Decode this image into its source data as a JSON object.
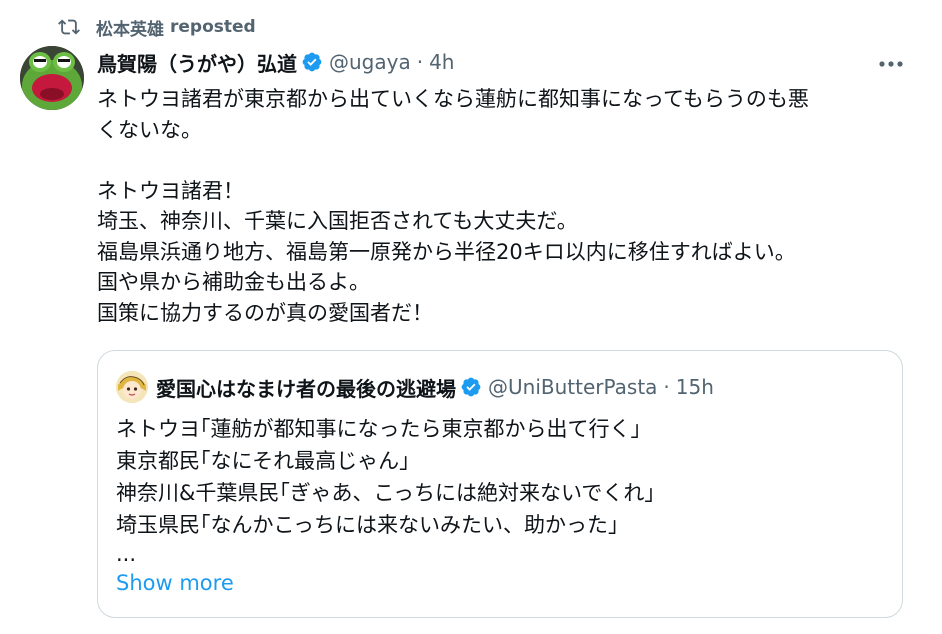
{
  "repost": {
    "user": "松本英雄",
    "label": "reposted",
    "icon": "repost-icon"
  },
  "post": {
    "display_name": "鳥賀陽（うがや）弘道",
    "handle": "@ugaya",
    "separator": "·",
    "time": "4h",
    "verified": true,
    "more_icon": "more-horizontal-icon",
    "lines": [
      "ネトウヨ諸君が東京都から出ていくなら蓮舫に都知事になってもらうのも悪",
      "くないな。",
      "",
      "ネトウヨ諸君！",
      "埼玉、神奈川、千葉に入国拒否されても大丈夫だ。",
      "福島県浜通り地方、福島第一原発から半径20キロ以内に移住すればよい。",
      "国や県から補助金も出るよ。",
      "国策に協力するのが真の愛国者だ！"
    ]
  },
  "quote": {
    "display_name": "愛国心はなまけ者の最後の逃避場",
    "handle": "@UniButterPasta",
    "separator": "·",
    "time": "15h",
    "verified": true,
    "lines": [
      "ネトウヨ｢蓮舫が都知事になったら東京都から出て行く｣",
      "東京都民｢なにそれ最高じゃん｣",
      "神奈川&千葉県民｢ぎゃあ、こっちには絶対来ないでくれ｣",
      "埼玉県民｢なんかこっちには来ないみたい、助かった｣",
      "..."
    ],
    "show_more": "Show more"
  },
  "colors": {
    "accent": "#1d9bf0",
    "muted": "#536471",
    "text": "#0f1419",
    "border": "#cfd9de"
  }
}
